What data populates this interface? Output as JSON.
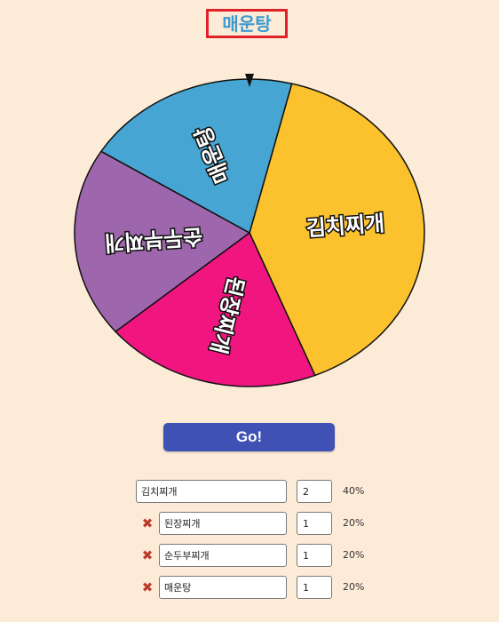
{
  "result": {
    "text": "매운탕"
  },
  "wheel": {
    "pointer_icon": "triangle-down-icon",
    "segments": [
      {
        "name": "김치찌개",
        "weight": 2,
        "color": "#fcc22d"
      },
      {
        "name": "된장찌개",
        "weight": 1,
        "color": "#f0157f"
      },
      {
        "name": "순두부찌개",
        "weight": 1,
        "color": "#9e66ac"
      },
      {
        "name": "매운탕",
        "weight": 1,
        "color": "#46a5d2"
      }
    ]
  },
  "go_button": {
    "label": "Go!"
  },
  "items": [
    {
      "name": "김치찌개",
      "weight": "2",
      "percent": "40%",
      "removable": false,
      "remove_icon": ""
    },
    {
      "name": "된장찌개",
      "weight": "1",
      "percent": "20%",
      "removable": true,
      "remove_icon": "✖"
    },
    {
      "name": "순두부찌개",
      "weight": "1",
      "percent": "20%",
      "removable": true,
      "remove_icon": "✖"
    },
    {
      "name": "매운탕",
      "weight": "1",
      "percent": "20%",
      "removable": true,
      "remove_icon": "✖"
    }
  ]
}
